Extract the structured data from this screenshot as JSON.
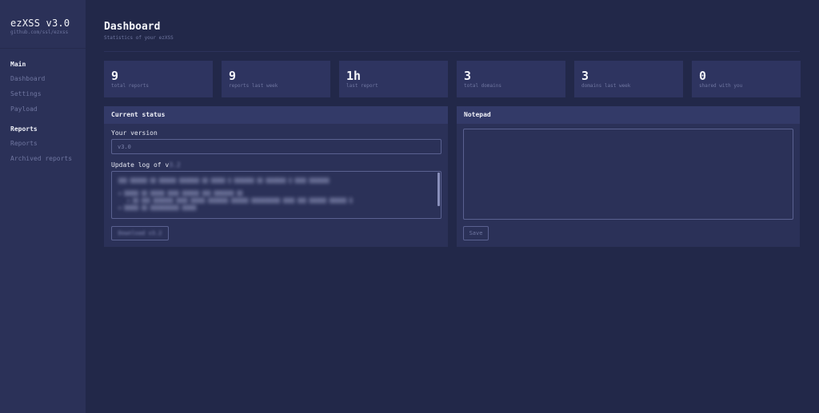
{
  "sidebar": {
    "brand_title": "ezXSS v3.0",
    "brand_sub": "github.com/ssl/ezxss",
    "sections": [
      {
        "title": "Main",
        "items": [
          "Dashboard",
          "Settings",
          "Payload"
        ]
      },
      {
        "title": "Reports",
        "items": [
          "Reports",
          "Archived reports"
        ]
      }
    ]
  },
  "header": {
    "title": "Dashboard",
    "subtitle": "Statistics of your ezXSS"
  },
  "stats": [
    {
      "value": "9",
      "label": "total reports"
    },
    {
      "value": "9",
      "label": "reports last week"
    },
    {
      "value": "1h",
      "label": "last report"
    },
    {
      "value": "3",
      "label": "total domains"
    },
    {
      "value": "3",
      "label": "domains last week"
    },
    {
      "value": "0",
      "label": "shared with you"
    }
  ],
  "status": {
    "title": "Current status",
    "version_label": "Your version",
    "version_value": "v3.0",
    "update_log_label": "Update log of v",
    "update_log_version": "3.2",
    "download_label": "Download v3.2"
  },
  "notepad": {
    "title": "Notepad",
    "content": "",
    "save_label": "Save"
  },
  "colors": {
    "background": "#222849",
    "sidebar": "#2b3158",
    "card": "#2e3460",
    "card_header": "#333a68",
    "muted_text": "#6f76a0",
    "border": "#5a6190"
  }
}
